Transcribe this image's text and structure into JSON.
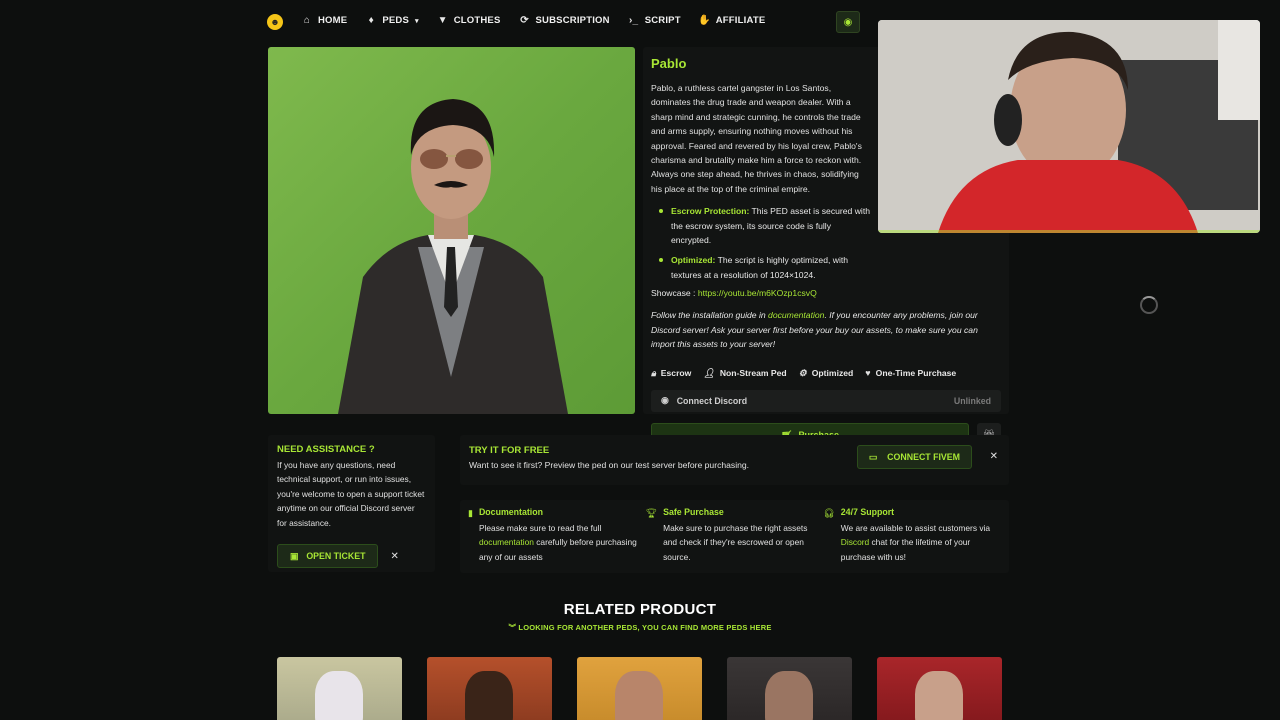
{
  "nav": {
    "logo_icon": "smiley-logo",
    "items": [
      {
        "label": "HOME",
        "icon": "home-icon"
      },
      {
        "label": "PEDS",
        "icon": "ped-icon",
        "has_dropdown": true
      },
      {
        "label": "CLOTHES",
        "icon": "shirt-icon"
      },
      {
        "label": "SUBSCRIPTION",
        "icon": "refresh-icon"
      },
      {
        "label": "SCRIPT",
        "icon": "terminal-icon"
      },
      {
        "label": "AFFILIATE",
        "icon": "handshake-icon"
      }
    ]
  },
  "product": {
    "title": "Pablo",
    "description": "Pablo, a ruthless cartel gangster in Los Santos, dominates the drug trade and weapon dealer. With a sharp mind and strategic cunning, he controls the trade and arms supply, ensuring nothing moves without his approval. Feared and revered by his loyal crew, Pablo's charisma and brutality make him a force to reckon with. Always one step ahead, he thrives in chaos, solidifying his place at the top of the criminal empire.",
    "bullets": [
      {
        "label": "Escrow Protection:",
        "text": " This PED asset is secured with the escrow system, its source code is fully encrypted."
      },
      {
        "label": "Optimized:",
        "text": " The script is highly optimized, with textures at a resolution of 1024×1024."
      }
    ],
    "showcase_label": "Showcase :",
    "showcase_link": "https://youtu.be/m6KOzp1csvQ",
    "install_pre": "Follow the installation guide in ",
    "install_link": "documentation",
    "install_post": ". If you encounter any problems, join our Discord server! Ask your server first before your buy our assets, to make sure you can import this assets to your server!",
    "features": [
      {
        "label": "Escrow",
        "icon": "lock-icon"
      },
      {
        "label": "Non-Stream Ped",
        "icon": "user-icon"
      },
      {
        "label": "Optimized",
        "icon": "user-gear-icon"
      },
      {
        "label": "One-Time Purchase",
        "icon": "heart-icon"
      }
    ],
    "connect_discord_label": "Connect Discord",
    "connect_discord_status": "Unlinked",
    "purchase_label": "Purchase"
  },
  "assist": {
    "title": "NEED ASSISTANCE ?",
    "text": "If you have any questions, need technical support, or run into issues, you're welcome to open a support ticket anytime on our official Discord server for assistance.",
    "button": "OPEN TICKET"
  },
  "tryfree": {
    "title": "TRY IT FOR FREE",
    "text": "Want to see it first? Preview the ped on our test server before purchasing.",
    "button": "CONNECT FIVEM"
  },
  "info": [
    {
      "title": "Documentation",
      "pre": "Please make sure to read the full ",
      "link": "documentation",
      "post": " carefully before purchasing any of our assets",
      "icon": "book-icon"
    },
    {
      "title": "Safe Purchase",
      "pre": "Make sure to purchase the right assets and check if they're escrowed or open source.",
      "link": "",
      "post": "",
      "icon": "trophy-icon"
    },
    {
      "title": "24/7 Support",
      "pre": "We are available to assist customers via ",
      "link": "Discord",
      "post": " chat for the lifetime of your purchase with us!",
      "icon": "headset-icon"
    }
  ],
  "related": {
    "title": "RELATED PRODUCT",
    "subtitle": "LOOKING FOR ANOTHER PEDS, YOU CAN FIND MORE PEDS HERE"
  },
  "colors": {
    "accent": "#a8e635",
    "background": "#0d0f0e",
    "panel": "#111312"
  }
}
